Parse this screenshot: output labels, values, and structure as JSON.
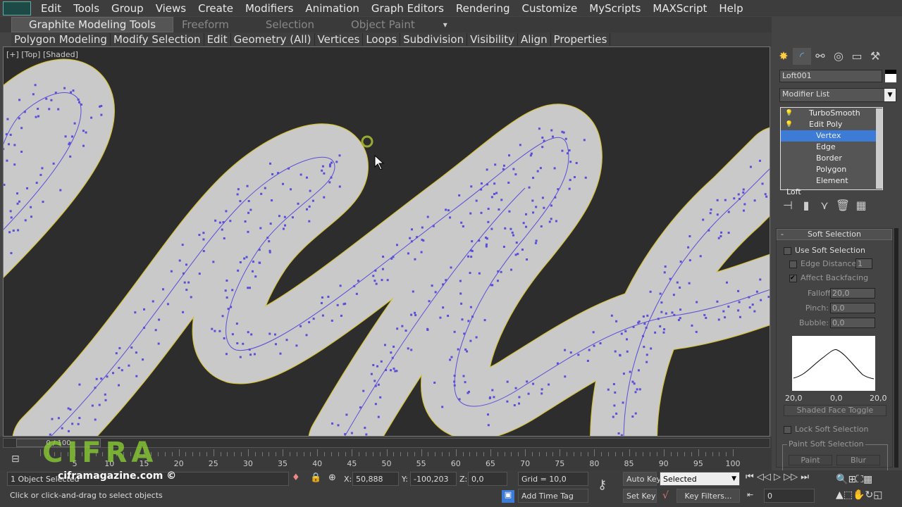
{
  "menubar": {
    "items": [
      "Edit",
      "Tools",
      "Group",
      "Views",
      "Create",
      "Modifiers",
      "Animation",
      "Graph Editors",
      "Rendering",
      "Customize",
      "MyScripts",
      "MAXScript",
      "Help"
    ]
  },
  "ribbon": {
    "tabs": [
      "Graphite Modeling Tools",
      "Freeform",
      "Selection",
      "Object Paint"
    ],
    "panels": [
      "Polygon Modeling",
      "Modify Selection",
      "Edit",
      "Geometry (All)",
      "Vertices",
      "Loops",
      "Subdivision",
      "Visibility",
      "Align",
      "Properties"
    ]
  },
  "viewport": {
    "label": "[+] [Top] [Shaded]",
    "shape_color": "#c9c9c9",
    "vertex_color": "#5b4fd8",
    "outline_color": "#d8c020"
  },
  "panel": {
    "object_name": "Loft001",
    "modifier_list": "Modifier List",
    "stack": [
      {
        "label": "TurboSmooth",
        "level": 0
      },
      {
        "label": "Edit Poly",
        "level": 0
      },
      {
        "label": "Vertex",
        "level": 1,
        "selected": true
      },
      {
        "label": "Edge",
        "level": 1
      },
      {
        "label": "Border",
        "level": 1
      },
      {
        "label": "Polygon",
        "level": 1
      },
      {
        "label": "Element",
        "level": 1
      },
      {
        "label": "Loft",
        "level": 0
      }
    ],
    "soft_selection": {
      "title": "Soft Selection",
      "use_soft_selection": "Use Soft Selection",
      "use_checked": false,
      "edge_distance": "Edge Distance:",
      "edge_distance_value": "1",
      "affect_backfacing": "Affect Backfacing",
      "affect_checked": true,
      "falloff_label": "Falloff:",
      "falloff": "20,0",
      "pinch_label": "Pinch:",
      "pinch": "0,0",
      "bubble_label": "Bubble:",
      "bubble": "0,0",
      "curve_labels": [
        "20,0",
        "0,0",
        "20,0"
      ],
      "shaded_face_toggle": "Shaded Face Toggle",
      "lock_soft_selection": "Lock Soft Selection",
      "paint_group": "Paint Soft Selection",
      "paint": "Paint",
      "blur": "Blur"
    }
  },
  "timeline": {
    "position": "0 / 100",
    "ticks": [
      0,
      5,
      10,
      15,
      20,
      25,
      30,
      35,
      40,
      45,
      50,
      55,
      60,
      65,
      70,
      75,
      80,
      85,
      90,
      95,
      100
    ]
  },
  "status": {
    "selection": "1 Object Selected",
    "prompt": "Click or click-and-drag to select objects",
    "x_label": "X:",
    "x": "50,888",
    "y_label": "Y:",
    "y": "-100,203",
    "z_label": "Z:",
    "z": "0,0",
    "grid": "Grid = 10,0",
    "add_time_tag": "Add Time Tag",
    "auto_key": "Auto Key",
    "set_key": "Set Key",
    "key_mode": "Selected",
    "key_filters": "Key Filters...",
    "frame": "0"
  },
  "watermark": {
    "logo": "CIFRA",
    "site": "ciframagazine.com ©"
  }
}
